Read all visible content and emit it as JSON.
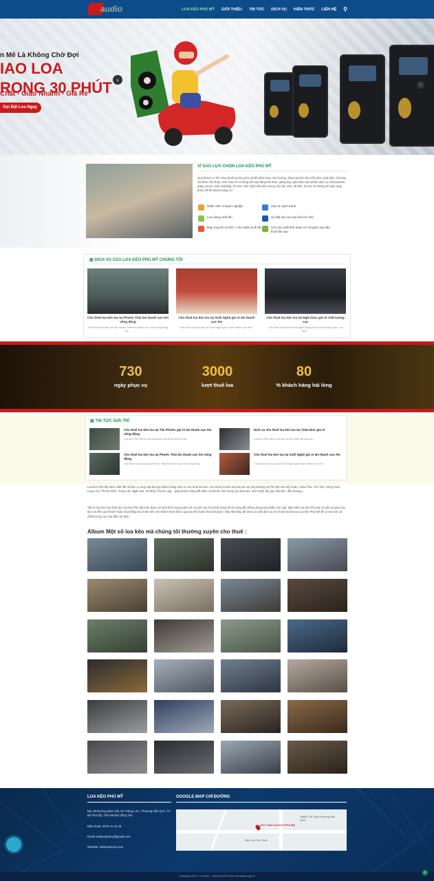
{
  "header": {
    "nav": [
      "LOA KÉO PHÚ MỸ",
      "GIỚI THIỆU",
      "TIN TỨC",
      "DỊCH VỤ",
      "KIẾN THỨC",
      "LIÊN HỆ"
    ],
    "logo_text": "audio",
    "search_icon": "search-icon"
  },
  "hero": {
    "line1": "n Mê Là Không Chờ Đợi",
    "line2": "IAO LOA",
    "line3": "RONG 30 PHÚT",
    "line4": "Chất - Giao Nhanh - Giá Rẻ",
    "cta": "Gọi Đặt Loa Ngay"
  },
  "why": {
    "title": "VÌ SAO LỰA CHỌN LOA KÉO PHÚ MỸ",
    "text": "Quý khách có thể chọn thuê loa kéo phú mỹ để phát nhạc như hướng, tham gia hội chơ triển lãm, phát biểu, hội họp, hội thảo, hội nhau, sinh hoạt cổ vũ bóng đá hoạt động thể thao, giảng dạy, giới thiệu sản phẩm dịch vụ, hát karaoke, party, picnic, team building, tổ chức sinh nhật, bầu tiệc mừng, tiệc tân niên, đi biển, du lịch và những lời hẹp cùng được để tết khách hàng cò !",
    "features": [
      "Nhân viên chuyên nghiệp.",
      "Giá cả cạnh tranh",
      "Loa uống xuất tên",
      "Uỷ đầy đủ các loại loa lớn nhỏ",
      "Đáp ứng kể cả thứ 7 chủ nhật và lễ tết.",
      "Cho loa chất lĩnh hoàn có chuyên mại nếu thuê lần sau"
    ]
  },
  "services": {
    "title": "DỊCH VỤ CỦA LOA KÉO PHÚ MỸ CHÚNG TÔI",
    "items": [
      {
        "title": "Cho thuê loa kéo loa tại Phước Thái âm thanh cực êm sống động",
        "desc": "Cho thuê loa kéo loa tại Phước Thái âm thanh cực êm sống động và..."
      },
      {
        "title": "Cho thuê loa kéo loa tại Suối Nghệ giá rẻ âm thanh cực êm",
        "desc": "Cho thuê loa kéo loa tại Suối Nghệ giá rẻ âm thanh cực êm..."
      },
      {
        "title": "Cho thuê loa kéo loa tại Ngãi Giao giá rẻ chất lượng cao",
        "desc": "Cho thuê loa kéo loa tại Ngãi Giao giá rẻ chất lượng cao Loa kéo..."
      }
    ]
  },
  "stats": [
    {
      "value": "730",
      "label": "ngày phục vụ"
    },
    {
      "value": "3000",
      "label": "lượt thuê loa"
    },
    {
      "value": "80",
      "label": "% khách hàng hài lòng"
    }
  ],
  "news": {
    "title": "TIN TỨC GIẢI TRÍ",
    "items": [
      {
        "title": "Cho thuê loa kéo loa tại Tân Phước giá rẻ âm thanh cực êm sống động",
        "desc": "Loa kéo Phú Mỹ là nhà đi chuyên cho thuê loa kéo loa..."
      },
      {
        "title": "Dịch vụ cho thuê loa kéo loa tại Châu Đức giá rẻ",
        "desc": "Loa kéo Phú Mỹ là nhà đơn vị cho thuê loa kéo loa..."
      },
      {
        "title": "Cho thuê loa kéo loa tại Phước Thái âm thanh cực êm sống động",
        "desc": "Cho thuê loa kéo loa tại Phước Thái âm thanh cực êm sống động..."
      },
      {
        "title": "Cho thuê loa kéo loa tại Suối Nghệ giá rẻ âm thanh cực êm",
        "desc": "Cho thuê loa kéo loa tại Suối Nghệ giá rẻ âm thanh cực êm..."
      }
    ]
  },
  "paragraphs": [
    "Loa kéo Phú Mỹ được biết đến là đơn vị cung cấp tất quý khách hàng dịch vụ cho thuê loa kéo, cho thuê loa kéo loa kéo tại các xã phường tại Phú Mỹ như Mỹ Xuân, Châu Pha, Tóc Tiên, Sông Xoài, Láng Lớn, Phước Bình, Tráng cát, Ngãi Hòa, Xã Mộp, Phước Lập... giúp khách hàng tiết kiệm và tiết lúc tính trong các dám tiệc, sinh nhật, tân gia, bữa tiệc, dẫu thoang...",
    "Tất cả loa kéo cho thuê tại Loa Kéo Phú Mỹ luôn được vệ sinh thời trung mạch sẽ, loa kéo luy cho thuê trong tốt sử dụng đã những dòng sản phẩm cao cấp. Đặc biệt Loa kéo Phú Mỹ có sẵn loa giao loa tận nơi đến quý khách hoặc hoạt động loa chính tiên cho khách thuê được qua loa để nhanh theo 30 phút ! Hãy đặt hàng để được ưu đãi dịch vụ cho thuê loa kéo tại Loa kéo Phú Mỹ để có loa mới và chất lượng cao nào đâm sứ điện."
  ],
  "album_title": "Album Một số loa kéo mà chúng tôi thường xuyên cho thuê :",
  "footer": {
    "col1_title": "LOA KÉO PHÚ MỸ",
    "address": "Địa chỉ:Đường Bình Giã, KP Trảng Lớn , Phường Hắc Dịch, TX Bà Phú Mỹ, Tỉnh Bà Rịa Vũng Tàu",
    "phone": "Điện thoại: 0979 41 22 48",
    "email": "Email: loakeophumy@gmail.com",
    "website": "Website: loakeophumy.com",
    "col2_title": "GOOGLE MAP CHỈ ĐƯỜNG",
    "map_labels": [
      "Cho Thuê Loa Kéo Phú Mỹ",
      "Dịch Vụ Cho Thuê",
      "UBND Thị Trấn Phường Hắc Dịch"
    ]
  },
  "copyright": "Copyright 2022 © Loa kéo - Thiết Kế bởi Theme wordpress giá rẻ"
}
